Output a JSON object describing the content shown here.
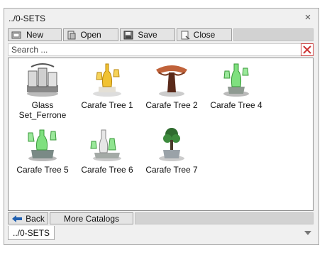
{
  "window": {
    "title": "../0-SETS",
    "close_glyph": "×"
  },
  "toolbar": {
    "new_label": "New",
    "open_label": "Open",
    "save_label": "Save",
    "close_label": "Close",
    "icons": [
      "new-icon",
      "open-icon",
      "save-icon",
      "close-doc-icon"
    ]
  },
  "search": {
    "placeholder": "Search ...",
    "value": "",
    "clear_icon": "clear-x-icon"
  },
  "catalog": {
    "items": [
      {
        "label": "Glass Set_Ferrone",
        "icon": "glass-set-thumbnail"
      },
      {
        "label": "Carafe Tree 1",
        "icon": "carafe-tree-yellow-thumbnail"
      },
      {
        "label": "Carafe Tree 2",
        "icon": "carafe-tree-brown-thumbnail"
      },
      {
        "label": "Carafe Tree 4",
        "icon": "carafe-tree-green-thumbnail"
      },
      {
        "label": "Carafe Tree 5",
        "icon": "carafe-tree-green-thumbnail"
      },
      {
        "label": "Carafe Tree 6",
        "icon": "carafe-tree-green-thumbnail"
      },
      {
        "label": "Carafe Tree 7",
        "icon": "carafe-tree-plant-thumbnail"
      }
    ]
  },
  "bottom": {
    "back_label": "Back",
    "more_label": "More Catalogs",
    "back_icon": "arrow-left-icon"
  },
  "path_tab": {
    "label": "../0-SETS"
  },
  "colors": {
    "window_bg": "#f0f0f0",
    "clear_red": "#cc3333",
    "back_arrow": "#1f5fb0",
    "glass_green": "#6fdc6f"
  }
}
